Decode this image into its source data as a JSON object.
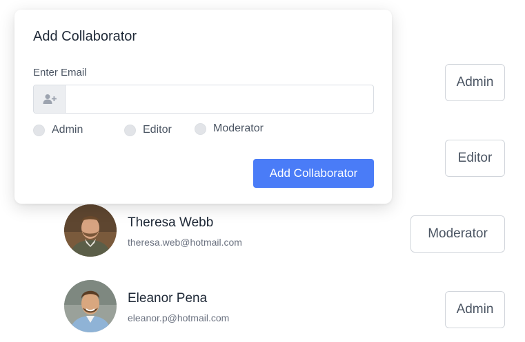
{
  "modal": {
    "title": "Add Collaborator",
    "email_label": "Enter Email",
    "email_value": "",
    "email_placeholder": "",
    "addon_icon": "add-user-icon",
    "roles": [
      "Admin",
      "Editor",
      "Moderator"
    ],
    "submit_label": "Add Collaborator"
  },
  "collaborators": [
    {
      "role": "Admin"
    },
    {
      "role": "Editor"
    },
    {
      "name": "Theresa Webb",
      "email": "theresa.web@hotmail.com",
      "role": "Moderator",
      "avatar": "avatar-man-beard"
    },
    {
      "name": "Eleanor Pena",
      "email": "eleanor.p@hotmail.com",
      "role": "Admin",
      "avatar": "avatar-man-smiling"
    }
  ],
  "colors": {
    "primary": "#4a7cf7",
    "border": "#d1d5db",
    "text": "#1f2937",
    "muted": "#6b7280"
  }
}
